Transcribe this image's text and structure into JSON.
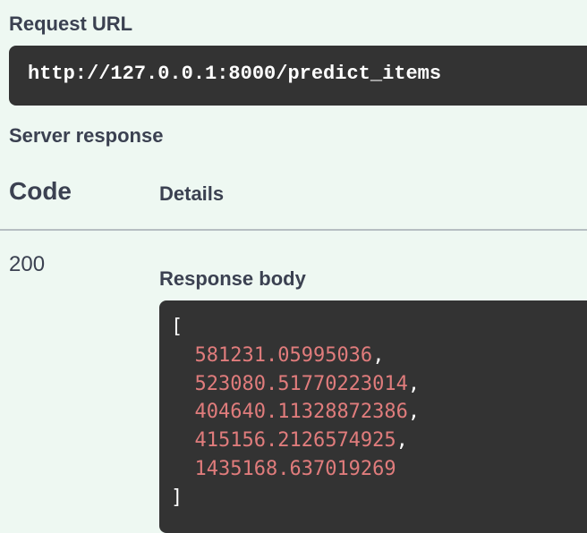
{
  "request": {
    "label": "Request URL",
    "url": "http://127.0.0.1:8000/predict_items"
  },
  "server_response": {
    "label": "Server response",
    "columns": {
      "code": "Code",
      "details": "Details"
    },
    "status_code": "200",
    "response_body_label": "Response body",
    "body": {
      "open_bracket": "[",
      "close_bracket": "]",
      "values": [
        {
          "value": "581231.05995036",
          "sep": ","
        },
        {
          "value": "523080.51770223014",
          "sep": ","
        },
        {
          "value": "404640.11328872386",
          "sep": ","
        },
        {
          "value": "415156.2126574925",
          "sep": ","
        },
        {
          "value": "1435168.637019269",
          "sep": ""
        }
      ]
    }
  },
  "colors": {
    "background": "#eef8f2",
    "code_background": "#333333",
    "number": "#e07c7c",
    "text": "#3b4151"
  }
}
